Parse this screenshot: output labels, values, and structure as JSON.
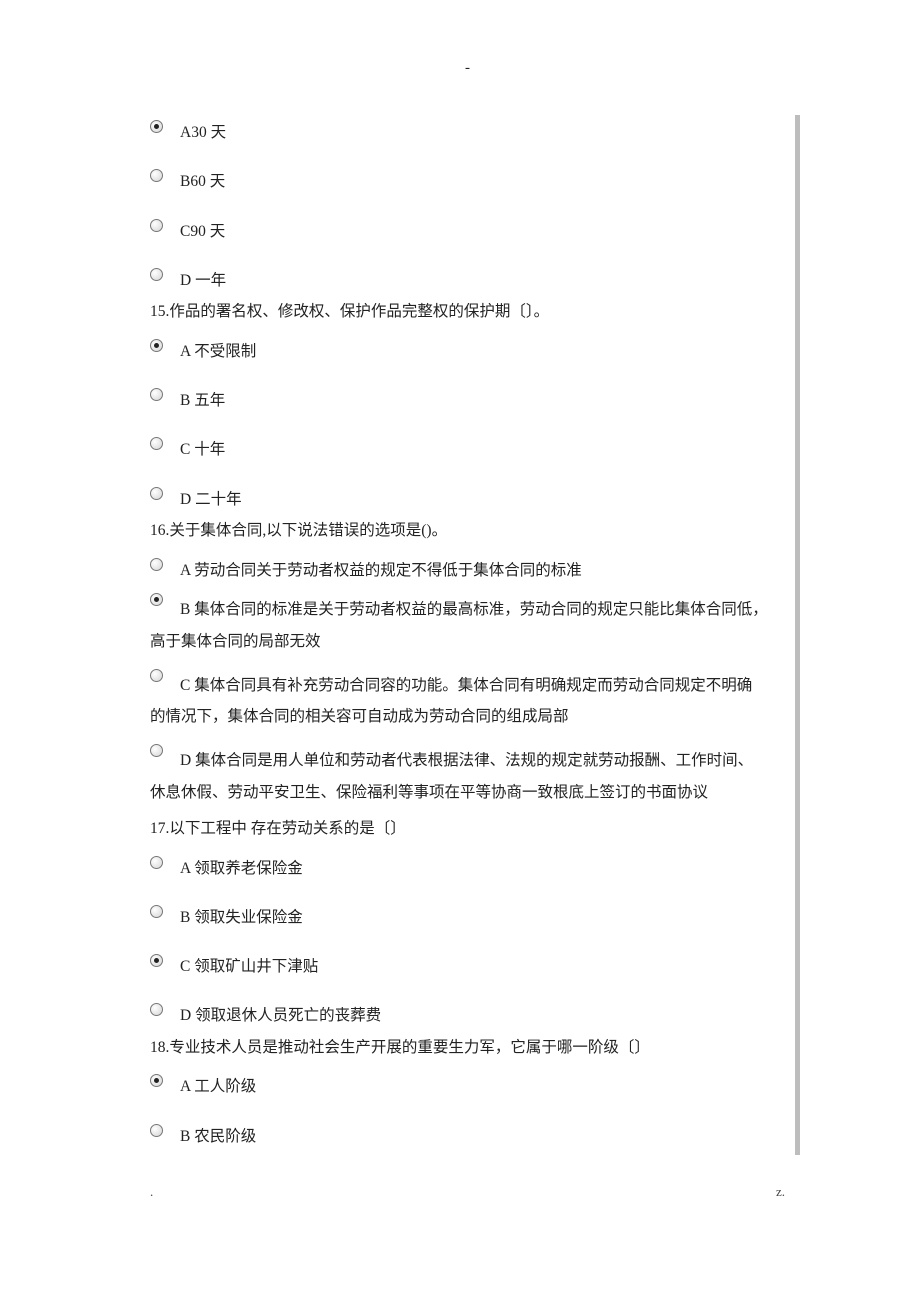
{
  "topMark": "-",
  "q14": {
    "options": [
      {
        "label": "A30 天",
        "selected": true
      },
      {
        "label": "B60 天",
        "selected": false
      },
      {
        "label": "C90 天",
        "selected": false
      },
      {
        "label": "D 一年",
        "selected": false
      }
    ]
  },
  "q15": {
    "prompt": "15.作品的署名权、修改权、保护作品完整权的保护期〔〕。",
    "options": [
      {
        "label": "A 不受限制",
        "selected": true
      },
      {
        "label": "B 五年",
        "selected": false
      },
      {
        "label": "C 十年",
        "selected": false
      },
      {
        "label": "D 二十年",
        "selected": false
      }
    ]
  },
  "q16": {
    "prompt": "16.关于集体合同,以下说法错误的选项是()。",
    "options": [
      {
        "label": "A 劳动合同关于劳动者权益的规定不得低于集体合同的标准",
        "selected": false
      },
      {
        "line1": "B 集体合同的标准是关于劳动者权益的最高标准，劳动合同的规定只能比集体合同低，",
        "line2": "高于集体合同的局部无效",
        "selected": true
      },
      {
        "line1": "C 集体合同具有补充劳动合同容的功能。集体合同有明确规定而劳动合同规定不明确",
        "line2": "的情况下，集体合同的相关容可自动成为劳动合同的组成局部",
        "selected": false
      },
      {
        "line1": "D 集体合同是用人单位和劳动者代表根据法律、法规的规定就劳动报酬、工作时间、",
        "line2": "休息休假、劳动平安卫生、保险福利等事项在平等协商一致根底上签订的书面协议",
        "selected": false
      }
    ]
  },
  "q17": {
    "prompt": "17.以下工程中 存在劳动关系的是〔〕",
    "options": [
      {
        "label": "A 领取养老保险金",
        "selected": false
      },
      {
        "label": "B 领取失业保险金",
        "selected": false
      },
      {
        "label": "C 领取矿山井下津贴",
        "selected": true
      },
      {
        "label": "D 领取退休人员死亡的丧葬费",
        "selected": false
      }
    ]
  },
  "q18": {
    "prompt": "18.专业技术人员是推动社会生产开展的重要生力军，它属于哪一阶级〔〕",
    "options": [
      {
        "label": "A 工人阶级",
        "selected": true
      },
      {
        "label": "B 农民阶级",
        "selected": false
      }
    ]
  },
  "footer": {
    "left": ".",
    "right": "z."
  }
}
